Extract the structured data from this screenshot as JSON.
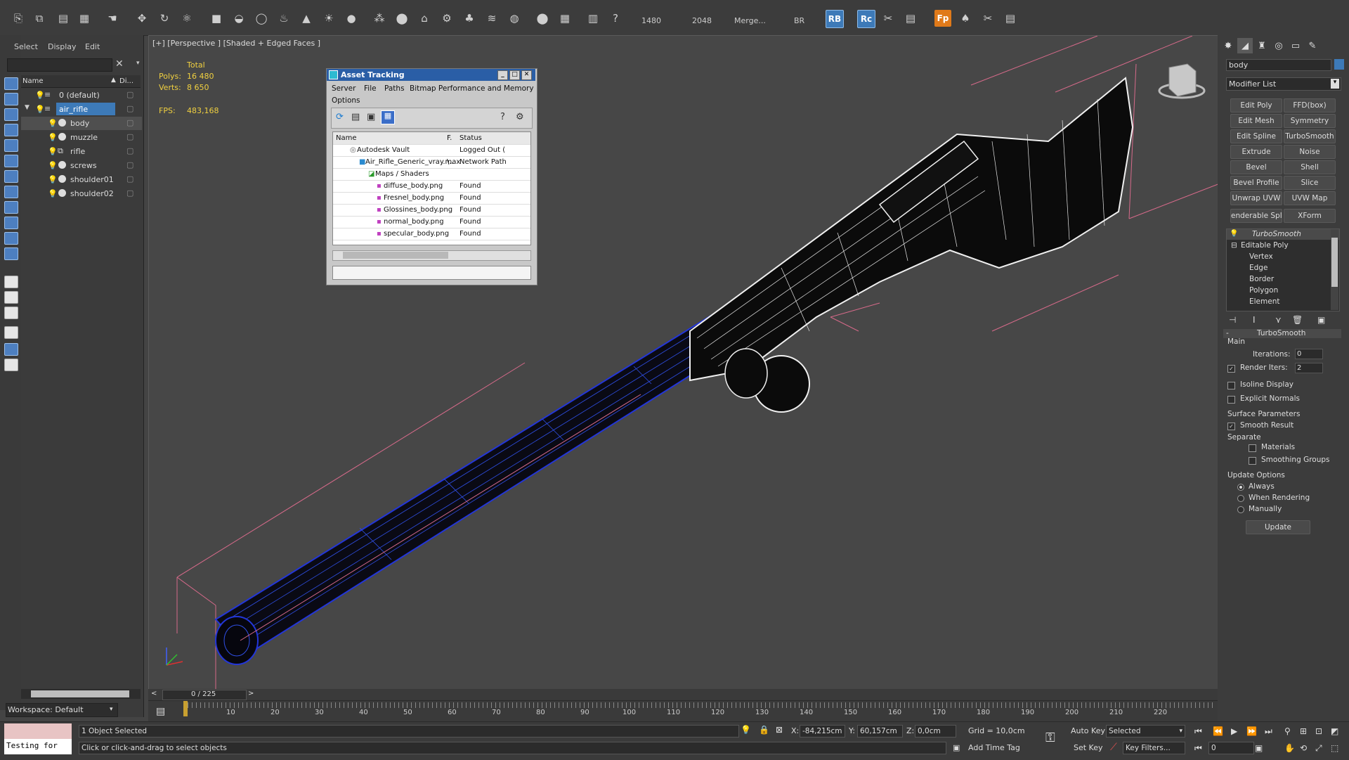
{
  "toolbar": {
    "readout_a": "1480",
    "readout_b": "2048",
    "merge_label": "Merge...",
    "br_label": "BR",
    "rb_label": "RB",
    "rc_label": "Rc",
    "fp_label": "Fp"
  },
  "explorer": {
    "menu": [
      "Select",
      "Display",
      "Edit"
    ],
    "col_name": "Name",
    "col_display": "Di...",
    "items": [
      {
        "label": "0 (default)",
        "level": 0
      },
      {
        "label": "air_rifle",
        "level": 0
      },
      {
        "label": "body",
        "level": 1
      },
      {
        "label": "muzzle",
        "level": 1
      },
      {
        "label": "rifle",
        "level": 1
      },
      {
        "label": "screws",
        "level": 1
      },
      {
        "label": "shoulder01",
        "level": 1
      },
      {
        "label": "shoulder02",
        "level": 1
      }
    ],
    "workspace": "Workspace: Default"
  },
  "viewport": {
    "label": "[+] [Perspective ] [Shaded + Edged Faces ]",
    "stats": {
      "total_label": "Total",
      "polys_label": "Polys:",
      "polys_value": "16 480",
      "verts_label": "Verts:",
      "verts_value": "8 650",
      "fps_label": "FPS:",
      "fps_value": "483,168"
    }
  },
  "asset_tracking": {
    "title": "Asset Tracking",
    "menu": [
      "Server",
      "File",
      "Paths",
      "Bitmap Performance and Memory",
      "Options"
    ],
    "columns": [
      "Name",
      "F.",
      "Status"
    ],
    "rows": [
      {
        "name": "Autodesk Vault",
        "f": "",
        "status": "Logged Out (",
        "indent": 1
      },
      {
        "name": "Air_Rifle_Generic_vray.max",
        "f": "\\..",
        "status": "Network Path",
        "indent": 2
      },
      {
        "name": "Maps / Shaders",
        "f": "",
        "status": "",
        "indent": 3
      },
      {
        "name": "diffuse_body.png",
        "f": "",
        "status": "Found",
        "indent": 4
      },
      {
        "name": "Fresnel_body.png",
        "f": "",
        "status": "Found",
        "indent": 4
      },
      {
        "name": "Glossines_body.png",
        "f": "",
        "status": "Found",
        "indent": 4
      },
      {
        "name": "normal_body.png",
        "f": "",
        "status": "Found",
        "indent": 4
      },
      {
        "name": "specular_body.png",
        "f": "",
        "status": "Found",
        "indent": 4
      }
    ]
  },
  "command_panel": {
    "object_name": "body",
    "modifier_list": "Modifier List",
    "modifier_buttons": [
      "Edit Poly",
      "FFD(box)",
      "Edit Mesh",
      "Symmetry",
      "Edit Spline",
      "TurboSmooth",
      "Extrude",
      "Noise",
      "Bevel",
      "Shell",
      "Bevel Profile",
      "Slice",
      "Unwrap UVW",
      "UVW Map",
      "enderable Splin",
      "XForm"
    ],
    "stack": [
      "TurboSmooth",
      "Editable Poly",
      "Vertex",
      "Edge",
      "Border",
      "Polygon",
      "Element"
    ],
    "rollout": {
      "title": "TurboSmooth",
      "main_label": "Main",
      "iterations_label": "Iterations:",
      "iterations_value": "0",
      "render_iters_label": "Render Iters:",
      "render_iters_value": "2",
      "isoline_label": "Isoline Display",
      "explicit_label": "Explicit Normals",
      "surface_label": "Surface Parameters",
      "smooth_label": "Smooth Result",
      "separate_label": "Separate",
      "materials_label": "Materials",
      "smoothing_groups_label": "Smoothing Groups",
      "update_options_label": "Update Options",
      "always_label": "Always",
      "when_rendering_label": "When Rendering",
      "manually_label": "Manually",
      "update_button": "Update"
    }
  },
  "timeline": {
    "frame": "0 / 225",
    "ticks": [
      "10",
      "20",
      "30",
      "40",
      "50",
      "60",
      "70",
      "80",
      "90",
      "100",
      "110",
      "120",
      "130",
      "140",
      "150",
      "160",
      "170",
      "180",
      "190",
      "200",
      "210",
      "220"
    ]
  },
  "status": {
    "maxscript": "Testing for",
    "selected": "1 Object Selected",
    "prompt": "Click or click-and-drag to select objects",
    "x_label": "X:",
    "x_value": "-84,215cm",
    "y_label": "Y:",
    "y_value": "60,157cm",
    "z_label": "Z:",
    "z_value": "0,0cm",
    "grid": "Grid = 10,0cm",
    "add_time_tag": "Add Time Tag",
    "auto_key": "Auto Key",
    "set_key": "Set Key",
    "selected_dropdown": "Selected",
    "key_filters": "Key Filters...",
    "frame_field": "0"
  },
  "colors": {
    "selection_blue": "#3d7ab8",
    "wire_blue": "#2336d8",
    "stat_yellow": "#f0d040"
  }
}
